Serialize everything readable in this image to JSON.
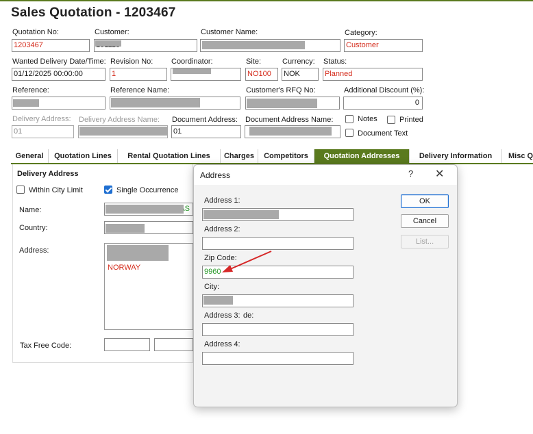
{
  "header": {
    "title": "Sales Quotation - 1203467"
  },
  "form": {
    "quotation_no": {
      "label": "Quotation No:",
      "value": "1203467"
    },
    "customer": {
      "label": "Customer:",
      "value": "101115"
    },
    "customer_name": {
      "label": "Customer Name:",
      "value": ""
    },
    "category": {
      "label": "Category:",
      "value": "Customer"
    },
    "wanted_delivery": {
      "label": "Wanted Delivery Date/Time:",
      "value": "01/12/2025 00:00:00"
    },
    "revision_no": {
      "label": "Revision No:",
      "value": "1"
    },
    "coordinator": {
      "label": "Coordinator:",
      "value": ""
    },
    "site": {
      "label": "Site:",
      "value": "NO100"
    },
    "currency": {
      "label": "Currency:",
      "value": "NOK"
    },
    "status": {
      "label": "Status:",
      "value": "Planned"
    },
    "reference": {
      "label": "Reference:",
      "value": ""
    },
    "reference_name": {
      "label": "Reference Name:",
      "value": ""
    },
    "customers_rfq": {
      "label": "Customer's RFQ No:",
      "value": ""
    },
    "additional_discount": {
      "label": "Additional Discount (%):",
      "value": "0"
    },
    "delivery_address": {
      "label": "Delivery Address:",
      "value": "01"
    },
    "delivery_address_name": {
      "label": "Delivery Address Name:",
      "value": ""
    },
    "document_address": {
      "label": "Document Address:",
      "value": "01"
    },
    "document_address_name": {
      "label": "Document Address Name:",
      "value": ""
    },
    "notes": {
      "label": "Notes"
    },
    "printed": {
      "label": "Printed"
    },
    "document_text": {
      "label": "Document Text"
    }
  },
  "tabs": [
    {
      "label": "General"
    },
    {
      "label": "Quotation Lines"
    },
    {
      "label": "Rental Quotation Lines"
    },
    {
      "label": "Charges"
    },
    {
      "label": "Competitors"
    },
    {
      "label": "Quotation Addresses"
    },
    {
      "label": "Delivery Information"
    },
    {
      "label": "Misc Q"
    }
  ],
  "delivery_panel": {
    "title": "Delivery Address",
    "within_city_limit": "Within City Limit",
    "single_occurrence": "Single Occurrence",
    "name_label": "Name:",
    "name_value_suffix": "AS",
    "country_label": "Country:",
    "address_label": "Address:",
    "address_country": "NORWAY",
    "tax_free_code_label": "Tax Free Code:"
  },
  "dialog": {
    "title": "Address",
    "help": "?",
    "close": "✕",
    "address1_label": "Address 1:",
    "address2_label": "Address 2:",
    "zip_label": "Zip Code:",
    "zip_value": "9960",
    "city_label": "City:",
    "address3_label": "Address 3:",
    "address3_overlap": "de:",
    "address4_label": "Address 4:",
    "ok": "OK",
    "cancel": "Cancel",
    "list": "List..."
  },
  "colors": {
    "accent": "#5a7a1e",
    "red_value": "#d42a1a",
    "green_value": "#2a9a2a",
    "annotation_arrow": "#d62828"
  }
}
